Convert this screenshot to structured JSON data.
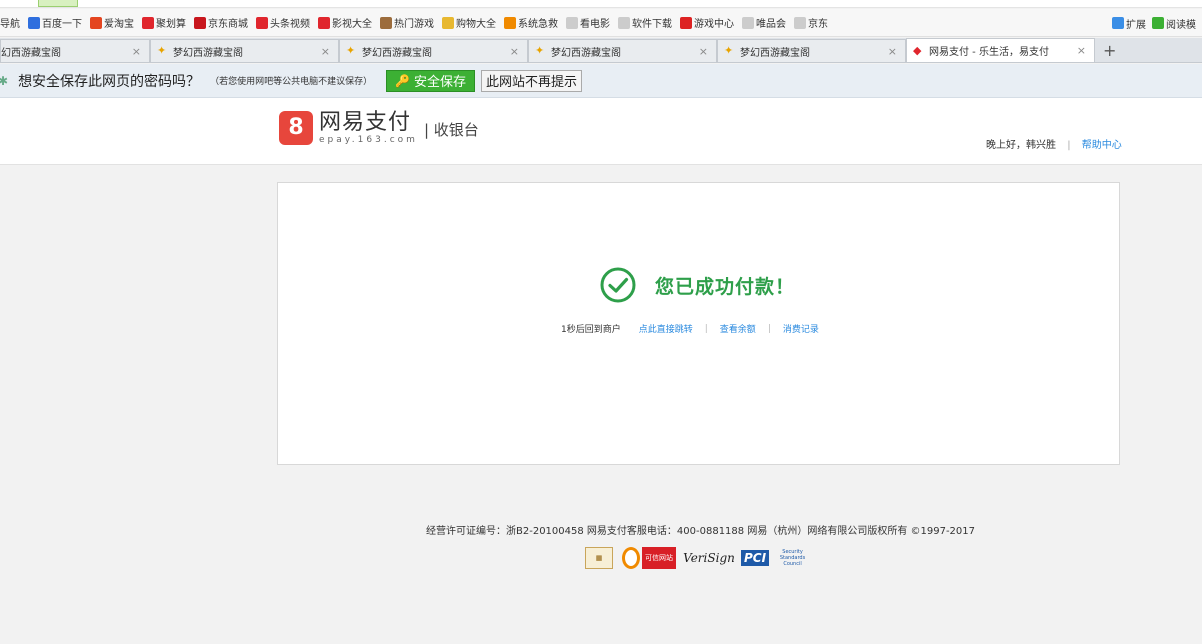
{
  "browser": {
    "bookmarks": [
      {
        "label": "导航",
        "icon": "nav-icon"
      },
      {
        "label": "百度一下",
        "icon": "baidu-icon"
      },
      {
        "label": "爱淘宝",
        "icon": "taobao-icon"
      },
      {
        "label": "聚划算",
        "icon": "juhuasuan-icon"
      },
      {
        "label": "京东商城",
        "icon": "jd-icon"
      },
      {
        "label": "头条视频",
        "icon": "video-icon"
      },
      {
        "label": "影视大全",
        "icon": "movie-icon"
      },
      {
        "label": "热门游戏",
        "icon": "game-icon"
      },
      {
        "label": "购物大全",
        "icon": "folder-icon"
      },
      {
        "label": "系统急救",
        "icon": "system-icon"
      },
      {
        "label": "看电影",
        "icon": "page-icon"
      },
      {
        "label": "软件下载",
        "icon": "page-icon"
      },
      {
        "label": "游戏中心",
        "icon": "game-center-icon"
      },
      {
        "label": "唯品会",
        "icon": "page-icon"
      },
      {
        "label": "京东",
        "icon": "page-icon"
      }
    ],
    "bookmarks_right": {
      "extensions": "扩展",
      "reader": "阅读模"
    },
    "tabs": [
      {
        "title": "幻西游藏宝阁",
        "active": false
      },
      {
        "title": "梦幻西游藏宝阁",
        "active": false
      },
      {
        "title": "梦幻西游藏宝阁",
        "active": false
      },
      {
        "title": "梦幻西游藏宝阁",
        "active": false
      },
      {
        "title": "梦幻西游藏宝阁",
        "active": false
      },
      {
        "title": "网易支付 - 乐生活，易支付",
        "active": true
      }
    ],
    "new_tab_label": "+",
    "password_bar": {
      "question": "想安全保存此网页的密码吗？",
      "note": "（若您使用网吧等公共电脑不建议保存）",
      "save_button": "安全保存",
      "never_button": "此网站不再提示"
    }
  },
  "header": {
    "logo_mark": "8",
    "brand_name": "网易支付",
    "brand_domain": "epay.163.com",
    "section": "| 收银台",
    "greeting": "晚上好，韩兴胜",
    "help_link": "帮助中心"
  },
  "result": {
    "message": "您已成功付款！",
    "countdown": "1秒后回到商户",
    "link_redirect": "点此直接跳转",
    "link_balance": "查看余额",
    "link_records": "消费记录",
    "success_color": "#2e9f4a"
  },
  "footer": {
    "license": "经营许可证编号：浙B2-20100458  网易支付客服电话：400-0881188  网易（杭州）网络有限公司版权所有 ©1997-2017",
    "badges": [
      "trust-badge",
      "credible-site-badge",
      "verisign-badge",
      "pci-badge"
    ],
    "badge_labels": {
      "b2": "可信网站",
      "b3": "VeriSign",
      "b4_main": "PCI",
      "b4_sub": "Security Standards Council"
    }
  }
}
